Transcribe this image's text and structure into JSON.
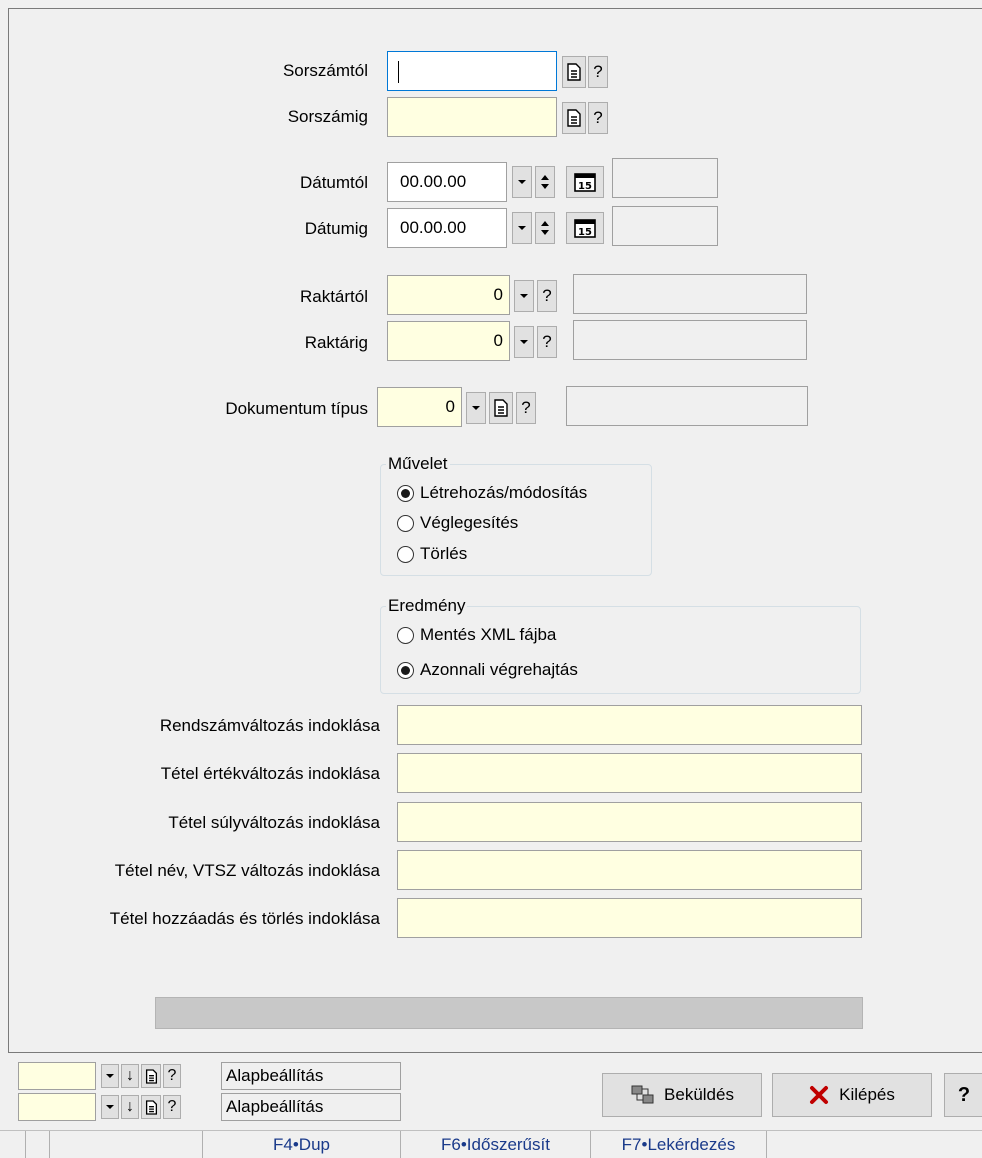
{
  "filters": {
    "sorszamtol": {
      "label": "Sorszámtól",
      "value": ""
    },
    "sorszamig": {
      "label": "Sorszámig",
      "value": ""
    },
    "datumtol": {
      "label": "Dátumtól",
      "value": "00.00.00"
    },
    "datumig": {
      "label": "Dátumig",
      "value": "00.00.00"
    },
    "raktartol": {
      "label": "Raktártól",
      "value": "0"
    },
    "raktarig": {
      "label": "Raktárig",
      "value": "0"
    },
    "dokumentum_tipus": {
      "label": "Dokumentum típus",
      "value": "0"
    }
  },
  "icons": {
    "lookup": "document-icon",
    "help": "?",
    "dropdown": "chevron-down-icon",
    "spin": "spin-icon",
    "calendar": "15"
  },
  "muvelet": {
    "legend": "Művelet",
    "options": [
      "Létrehozás/módosítás",
      "Véglegesítés",
      "Törlés"
    ],
    "selected_index": 0
  },
  "eredmeny": {
    "legend": "Eredmény",
    "options": [
      "Mentés XML fájba",
      "Azonnali végrehajtás"
    ],
    "selected_index": 1
  },
  "reasons": [
    {
      "label": "Rendszámváltozás indoklása",
      "value": ""
    },
    {
      "label": "Tétel értékváltozás indoklása",
      "value": ""
    },
    {
      "label": "Tétel súlyváltozás indoklása",
      "value": ""
    },
    {
      "label": "Tétel név, VTSZ változás indoklása",
      "value": ""
    },
    {
      "label": "Tétel hozzáadás és törlés indoklása",
      "value": ""
    }
  ],
  "progress": {
    "value": 0
  },
  "bottom": {
    "presets": [
      {
        "value": "",
        "label": "Alapbeállítás"
      },
      {
        "value": "",
        "label": "Alapbeállítás"
      }
    ],
    "submit_label": "Beküldés",
    "exit_label": "Kilépés",
    "help_label": "?"
  },
  "statusbar": [
    "",
    "F4•Dup",
    "F6•Időszerűsít",
    "F7•Lekérdezés"
  ],
  "colors": {
    "input_bg": "#ffffe1",
    "focus_border": "#0078d7",
    "exit_icon": "#c00000"
  }
}
